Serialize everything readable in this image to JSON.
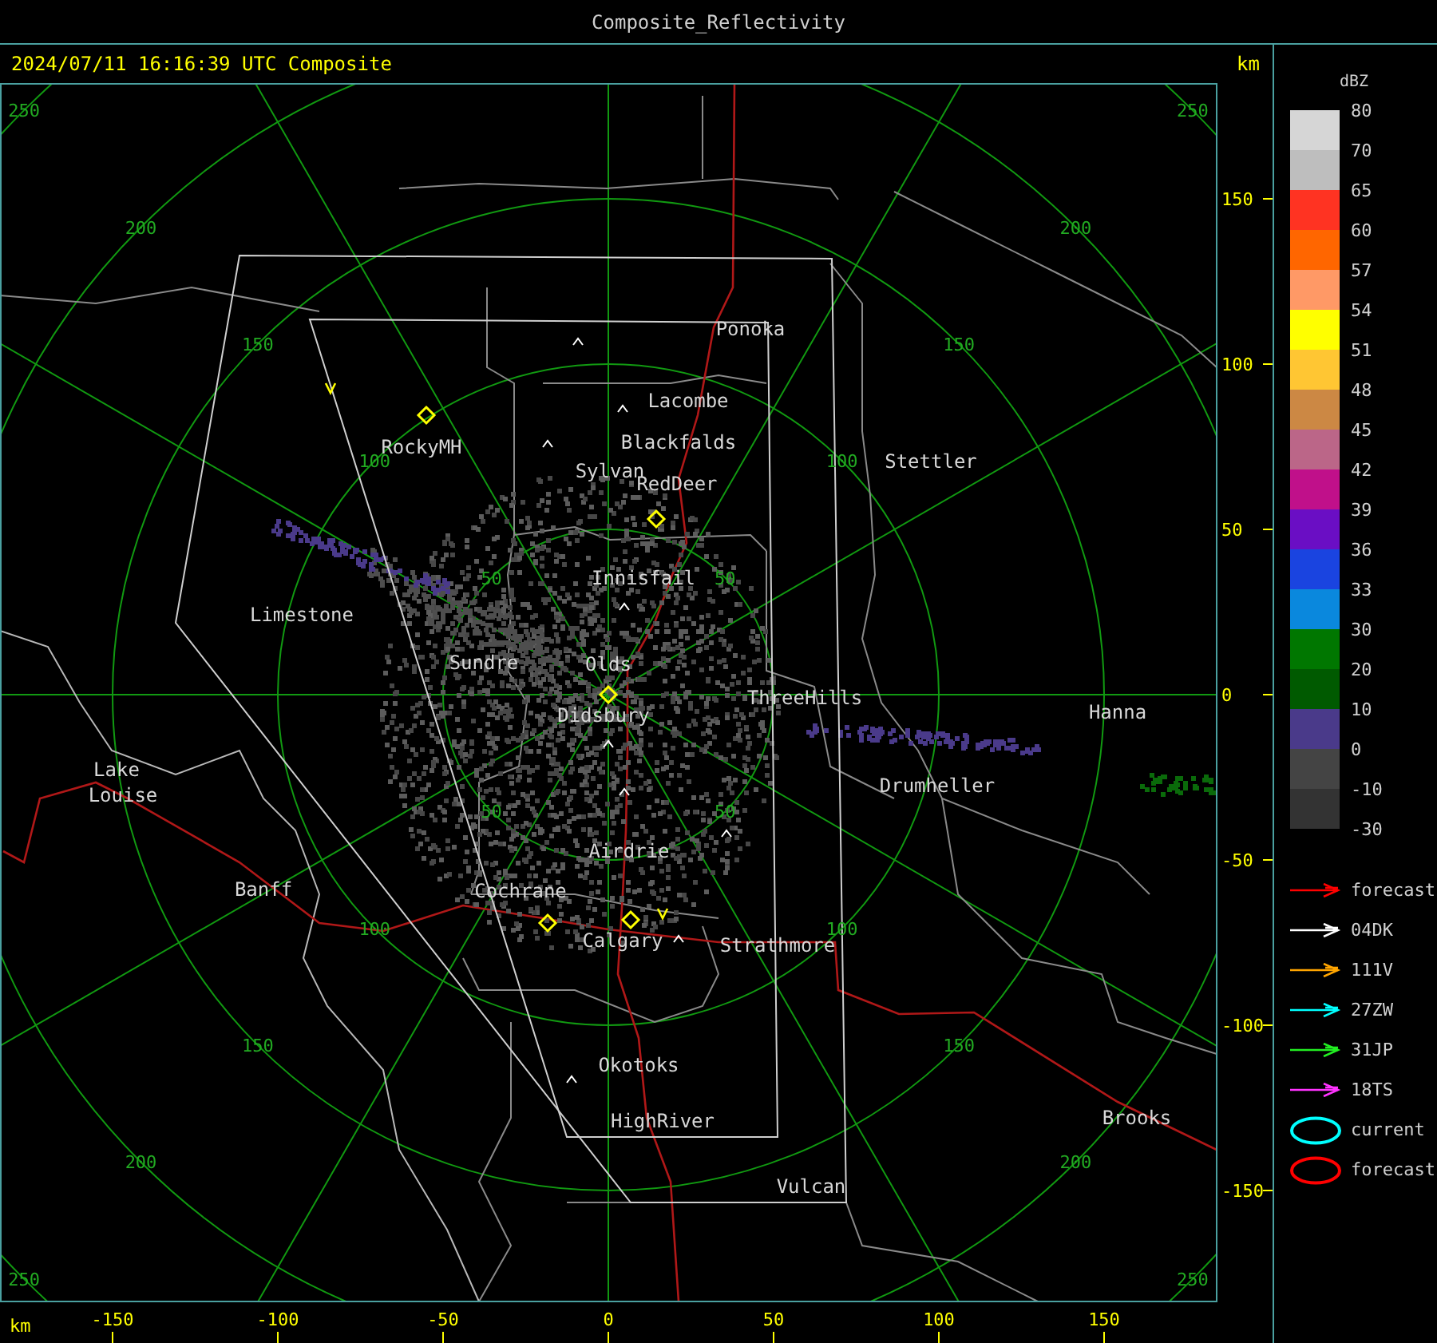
{
  "window": {
    "title": "Composite_Reflectivity"
  },
  "header": {
    "timestamp": "2024/07/11 16:16:39 UTC Composite",
    "unit": "km"
  },
  "map": {
    "places": [
      {
        "name": "Ponoka"
      },
      {
        "name": "Lacombe"
      },
      {
        "name": "Blackfalds"
      },
      {
        "name": "Sylvan"
      },
      {
        "name": "RedDeer"
      },
      {
        "name": "RockyMH"
      },
      {
        "name": "Stettler"
      },
      {
        "name": "Innisfail"
      },
      {
        "name": "Limestone"
      },
      {
        "name": "Sundre"
      },
      {
        "name": "Olds"
      },
      {
        "name": "Didsbury"
      },
      {
        "name": "ThreeHills"
      },
      {
        "name": "Hanna"
      },
      {
        "name": "Lake"
      },
      {
        "name": "Louise"
      },
      {
        "name": "Drumheller"
      },
      {
        "name": "Airdrie"
      },
      {
        "name": "Banff"
      },
      {
        "name": "Cochrane"
      },
      {
        "name": "Calgary"
      },
      {
        "name": "Strathmore"
      },
      {
        "name": "Okotoks"
      },
      {
        "name": "HighRiver"
      },
      {
        "name": "Brooks"
      },
      {
        "name": "Vulcan"
      }
    ],
    "range_rings": [
      {
        "labels": [
          "50",
          "50",
          "50",
          "50"
        ]
      },
      {
        "labels": [
          "100",
          "100",
          "100",
          "100"
        ]
      },
      {
        "labels": [
          "150",
          "150",
          "150",
          "150"
        ]
      },
      {
        "labels": [
          "200",
          "200",
          "200",
          "200"
        ]
      },
      {
        "labels": [
          "250",
          "250",
          "250",
          "250"
        ]
      }
    ]
  },
  "axes": {
    "y_ticks": [
      "150",
      "100",
      "50",
      "0",
      "-50",
      "-100",
      "-150"
    ],
    "x_unit": "km",
    "x_ticks": [
      "-150",
      "-100",
      "-50",
      "0",
      "50",
      "100",
      "150"
    ]
  },
  "legend": {
    "unit": "dBZ",
    "labels": [
      "80",
      "70",
      "65",
      "60",
      "57",
      "54",
      "51",
      "48",
      "45",
      "42",
      "39",
      "36",
      "33",
      "30",
      "20",
      "10",
      "0",
      "-10",
      "-30"
    ],
    "bins": [
      {
        "color": "#d6d6d6"
      },
      {
        "color": "#bebebe"
      },
      {
        "color": "#ff3322"
      },
      {
        "color": "#ff6600"
      },
      {
        "color": "#ff9966"
      },
      {
        "color": "#ffff00"
      },
      {
        "color": "#ffc633"
      },
      {
        "color": "#cc8844"
      },
      {
        "color": "#bb6688"
      },
      {
        "color": "#c0108a"
      },
      {
        "color": "#6a0ec4"
      },
      {
        "color": "#1a44e0"
      },
      {
        "color": "#0a88dd"
      },
      {
        "color": "#007700"
      },
      {
        "color": "#005a00"
      },
      {
        "color": "#4a3a8a"
      },
      {
        "color": "#444444"
      },
      {
        "color": "#333333"
      }
    ]
  },
  "tracks": [
    {
      "kind": "arrow",
      "label": "forecast",
      "color": "#ff0000"
    },
    {
      "kind": "arrow",
      "label": "04DK",
      "color": "#ffffff"
    },
    {
      "kind": "arrow",
      "label": "111V",
      "color": "#ffa500"
    },
    {
      "kind": "arrow",
      "label": "27ZW",
      "color": "#00ffff"
    },
    {
      "kind": "arrow",
      "label": "31JP",
      "color": "#22ee22"
    },
    {
      "kind": "arrow",
      "label": "18TS",
      "color": "#ff33ff"
    },
    {
      "kind": "ellipse",
      "label": "current",
      "color": "#00ffff"
    },
    {
      "kind": "ellipse",
      "label": "forecast",
      "color": "#ff0000"
    }
  ]
}
